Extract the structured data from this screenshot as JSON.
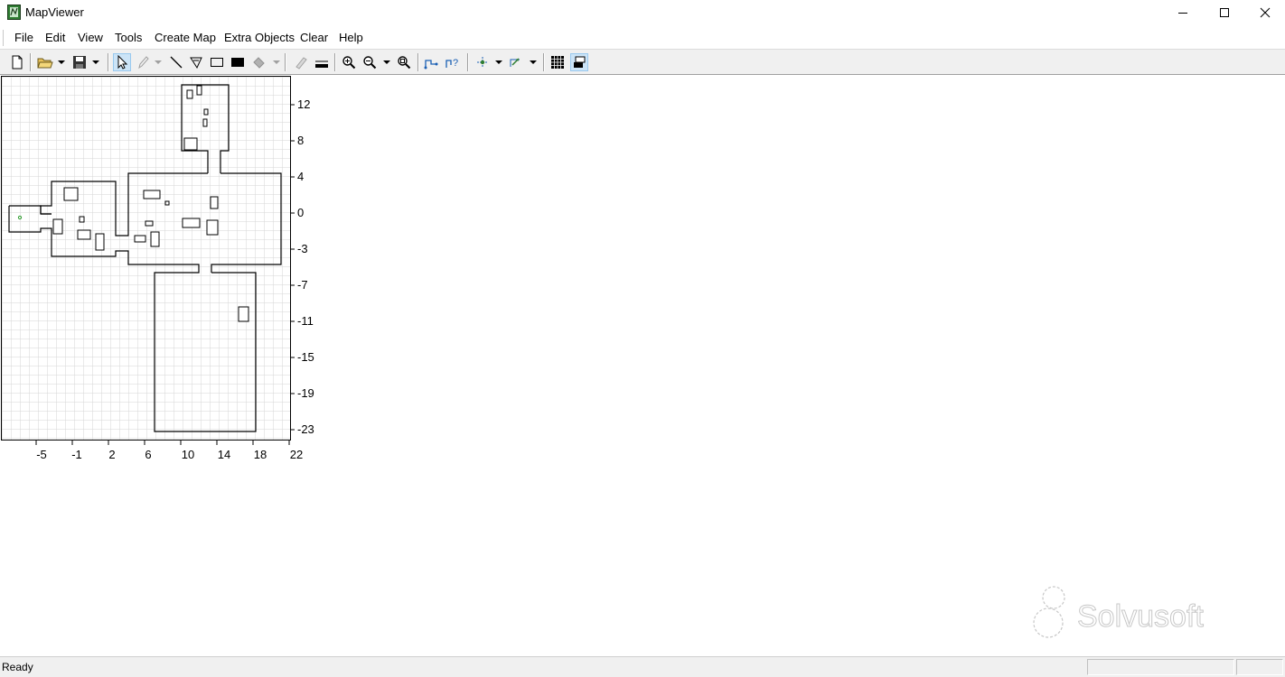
{
  "window": {
    "title": "MapViewer",
    "app_icon": "mapviewer-app-icon"
  },
  "menu": [
    {
      "label": "File"
    },
    {
      "label": "Edit"
    },
    {
      "label": "View"
    },
    {
      "label": "Tools"
    },
    {
      "label": "Create Map"
    },
    {
      "label": "Extra Objects"
    },
    {
      "label": "Clear"
    },
    {
      "label": "Help"
    }
  ],
  "toolbar": {
    "icons": [
      "new-file-icon",
      "open-folder-icon",
      "save-icon",
      "select-arrow-icon",
      "pencil-icon",
      "line-icon",
      "polygon-icon",
      "rectangle-icon",
      "filled-rectangle-icon",
      "fill-bucket-icon",
      "eraser-icon",
      "line-width-icon",
      "zoom-in-icon",
      "zoom-out-icon",
      "zoom-fit-icon",
      "path-icon",
      "path-query-icon",
      "waypoint-icon",
      "robot-pose-icon",
      "grid-toggle-icon",
      "layer-toggle-icon"
    ]
  },
  "map": {
    "x_ticks": [
      "-5",
      "-1",
      "2",
      "6",
      "10",
      "14",
      "18",
      "22"
    ],
    "y_ticks": [
      "12",
      "8",
      "4",
      "0",
      "-3",
      "-7",
      "-11",
      "-15",
      "-19",
      "-23"
    ]
  },
  "watermark": {
    "text": "Solvusoft"
  },
  "status": {
    "text": "Ready"
  }
}
